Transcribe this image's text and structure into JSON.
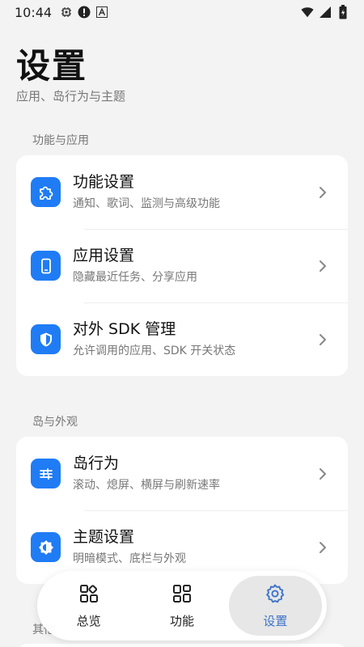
{
  "status_bar": {
    "time": "10:44",
    "left_icons": [
      "chip-icon",
      "alert-icon",
      "font-a-icon"
    ],
    "right_icons": [
      "wifi-icon",
      "signal-icon",
      "battery-icon"
    ]
  },
  "header": {
    "title": "设置",
    "subtitle": "应用、岛行为与主题"
  },
  "sections": [
    {
      "title": "功能与应用",
      "items": [
        {
          "icon": "puzzle-icon",
          "title": "功能设置",
          "description": "通知、歌词、监测与高级功能"
        },
        {
          "icon": "phone-icon",
          "title": "应用设置",
          "description": "隐藏最近任务、分享应用"
        },
        {
          "icon": "shield-icon",
          "title": "对外 SDK 管理",
          "description": "允许调用的应用、SDK 开关状态"
        }
      ]
    },
    {
      "title": "岛与外观",
      "items": [
        {
          "icon": "sliders-icon",
          "title": "岛行为",
          "description": "滚动、熄屏、横屏与刷新速率"
        },
        {
          "icon": "theme-icon",
          "title": "主题设置",
          "description": "明暗模式、底栏与外观"
        }
      ]
    },
    {
      "title": "其他",
      "items": []
    }
  ],
  "bottom_nav": {
    "items": [
      {
        "label": "总览",
        "icon": "grid-overview-icon",
        "active": false
      },
      {
        "label": "功能",
        "icon": "grid-function-icon",
        "active": false
      },
      {
        "label": "设置",
        "icon": "settings-gear-icon",
        "active": true
      }
    ]
  },
  "colors": {
    "accent": "#1f7cf5",
    "nav_active_text": "#3c73c9",
    "background": "#f3f3f3",
    "card": "#ffffff"
  }
}
